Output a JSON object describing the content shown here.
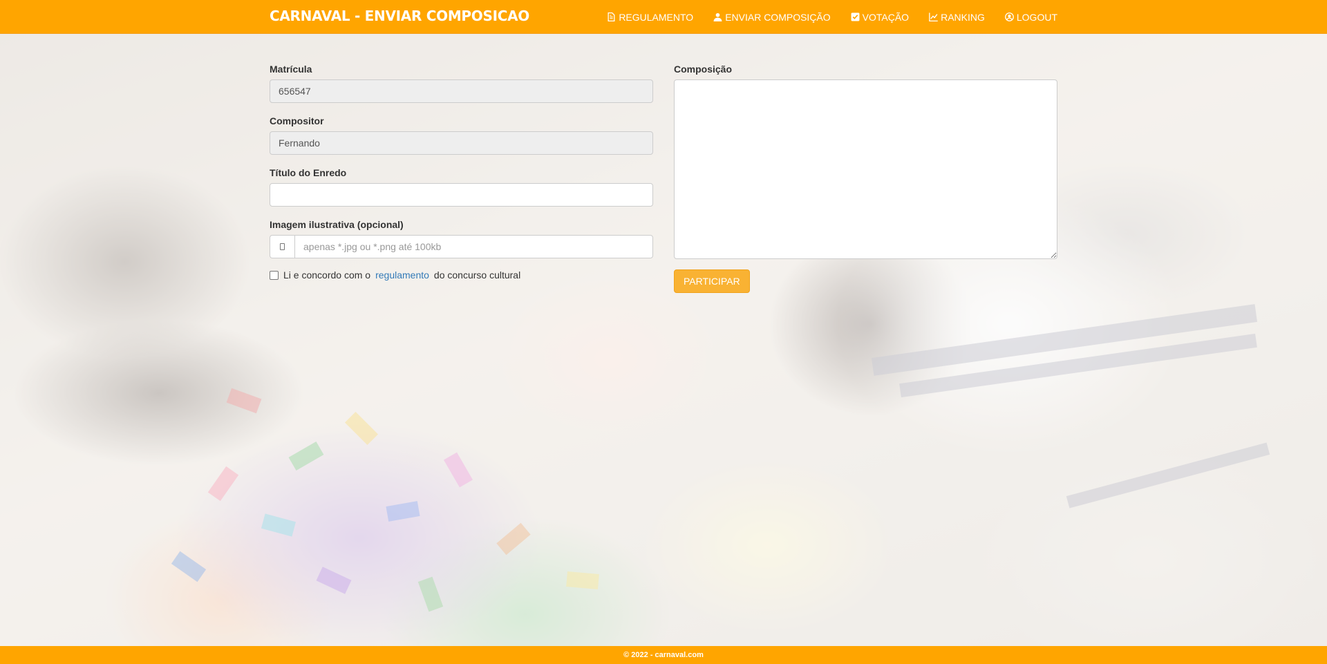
{
  "navbar": {
    "brand": "CARNAVAL - ENVIAR COMPOSICAO",
    "items": [
      {
        "label": "REGULAMENTO",
        "icon": "file-text-icon"
      },
      {
        "label": "ENVIAR COMPOSIÇÃO",
        "icon": "upload-user-icon"
      },
      {
        "label": "VOTAÇÃO",
        "icon": "check-square-icon"
      },
      {
        "label": "RANKING",
        "icon": "line-chart-icon"
      },
      {
        "label": "LOGOUT",
        "icon": "user-circle-icon"
      }
    ],
    "color": "#ffa500"
  },
  "form": {
    "matricula_label": "Matrícula",
    "matricula_value": "656547",
    "compositor_label": "Compositor",
    "compositor_value": "Fernando",
    "titulo_label": "Título do Enredo",
    "titulo_value": "",
    "imagem_label": "Imagem ilustrativa (opcional)",
    "imagem_placeholder": "apenas *.jpg ou *.png até 100kb",
    "imagem_icon": "file-icon",
    "terms_prefix": "Li e concordo com o",
    "terms_link": "regulamento",
    "terms_suffix": "do concurso cultural",
    "composicao_label": "Composição",
    "composicao_value": "",
    "submit_label": "PARTICIPAR",
    "submit_color": "#f9b233"
  },
  "footer": {
    "text": "© 2022 - carnaval.com"
  }
}
